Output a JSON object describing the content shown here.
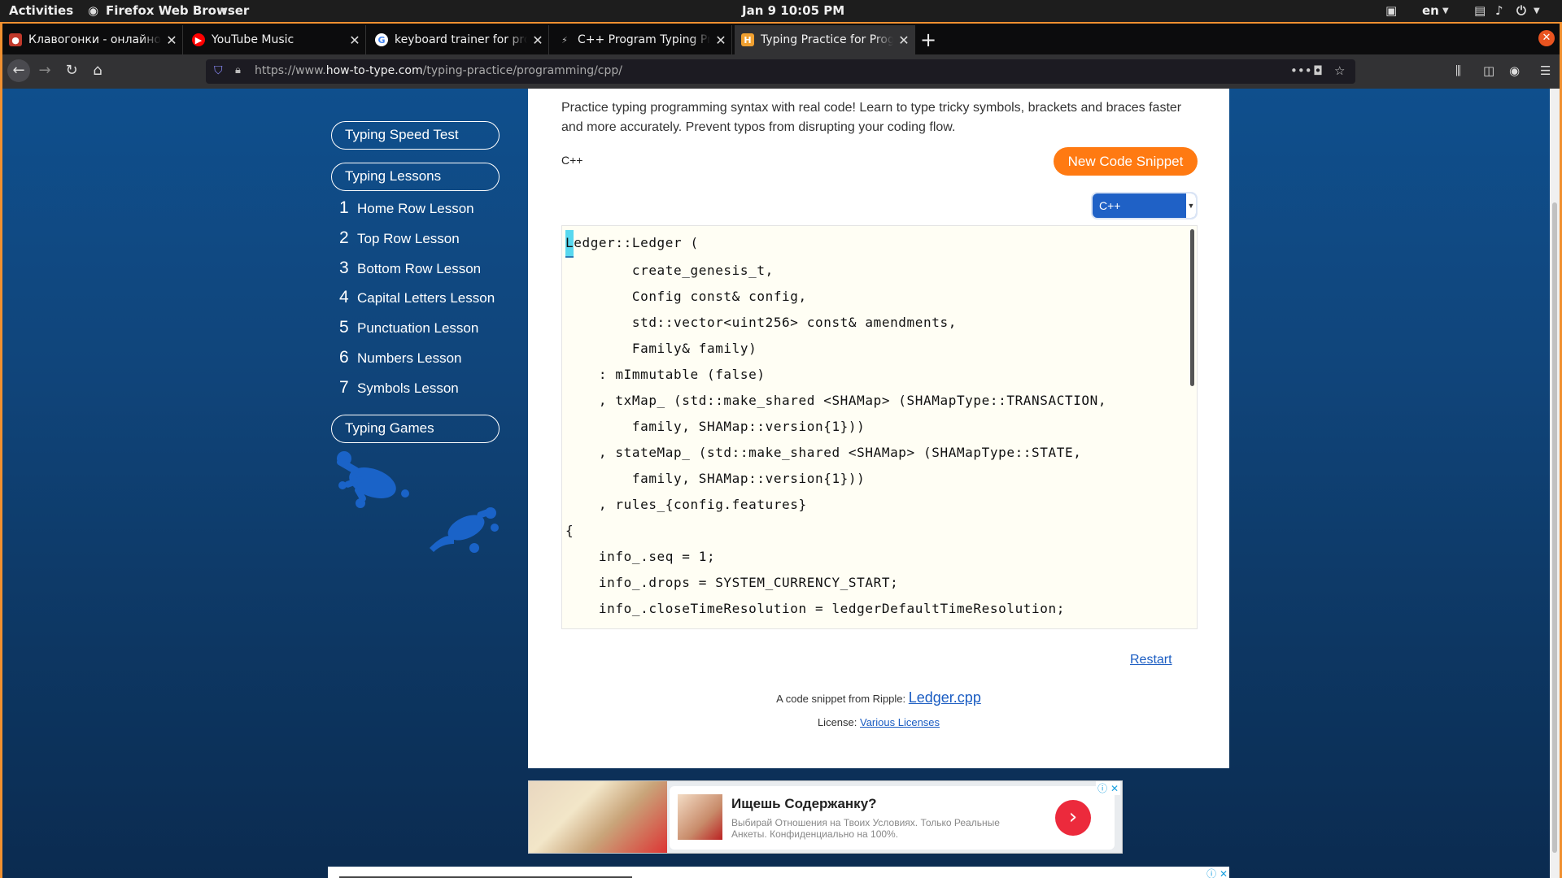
{
  "topbar": {
    "activities": "Activities",
    "app_name": "Firefox Web Browser",
    "clock": "Jan 9  10:05 PM",
    "lang": "en"
  },
  "tabs": [
    {
      "title": "Клавогонки - онлайновый",
      "favicon_color": "#c0392b"
    },
    {
      "title": "YouTube Music",
      "favicon_color": "#ff0000"
    },
    {
      "title": "keyboard trainer for progra",
      "favicon_color": "#ffffff"
    },
    {
      "title": "C++ Program Typing Practic",
      "favicon_color": "#333333"
    },
    {
      "title": "Typing Practice for Program",
      "favicon_color": "#f0a030"
    }
  ],
  "urlbar": {
    "prefix": "https://www.",
    "domain": "how-to-type.com",
    "path": "/typing-practice/programming/cpp/"
  },
  "sidebar": {
    "speed_test": "Typing Speed Test",
    "lessons_header": "Typing Lessons",
    "lessons": [
      {
        "num": "1",
        "label": "Home Row Lesson"
      },
      {
        "num": "2",
        "label": "Top Row Lesson"
      },
      {
        "num": "3",
        "label": "Bottom Row Lesson"
      },
      {
        "num": "4",
        "label": "Capital Letters Lesson"
      },
      {
        "num": "5",
        "label": "Punctuation Lesson"
      },
      {
        "num": "6",
        "label": "Numbers Lesson"
      },
      {
        "num": "7",
        "label": "Symbols Lesson"
      }
    ],
    "games": "Typing Games"
  },
  "main": {
    "intro": "Practice typing programming syntax with real code! Learn to type tricky symbols, brackets and braces faster and more accurately. Prevent typos from disrupting your coding flow.",
    "language_label": "C++",
    "new_snippet_button": "New Code Snippet",
    "language_select": "C++",
    "code_first_char": "L",
    "code_rest": "edger::Ledger (\n        create_genesis_t,\n        Config const& config,\n        std::vector<uint256> const& amendments,\n        Family& family)\n    : mImmutable (false)\n    , txMap_ (std::make_shared <SHAMap> (SHAMapType::TRANSACTION,\n        family, SHAMap::version{1}))\n    , stateMap_ (std::make_shared <SHAMap> (SHAMapType::STATE,\n        family, SHAMap::version{1}))\n    , rules_{config.features}\n{\n    info_.seq = 1;\n    info_.drops = SYSTEM_CURRENCY_START;\n    info_.closeTimeResolution = ledgerDefaultTimeResolution;",
    "restart": "Restart",
    "credit_text": "A code snippet from Ripple: ",
    "credit_link": "Ledger.cpp",
    "license_text": "License: ",
    "license_link": "Various Licenses"
  },
  "ad": {
    "title": "Ищешь Содержанку?",
    "text": "Выбирай Отношения на Твоих Условиях. Только Реальные Анкеты. Конфиденциально на 100%."
  },
  "colors": {
    "accent_orange": "#ff7a12",
    "select_blue": "#1f61c6",
    "link_blue": "#1a5cc2",
    "page_bg_blue": "#0f4f8d"
  }
}
